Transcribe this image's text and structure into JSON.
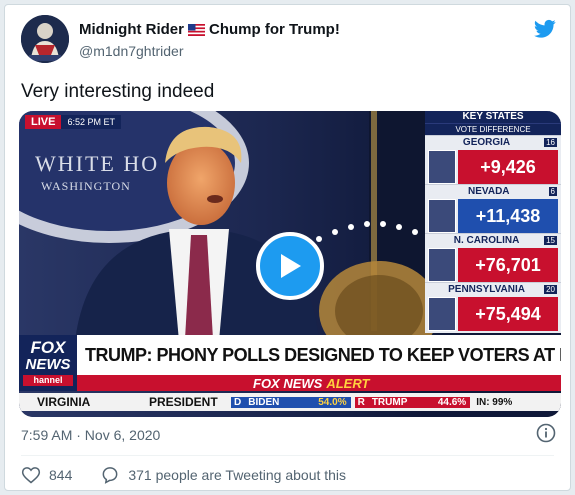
{
  "tweet": {
    "display_name": "Midnight Rider",
    "name_suffix": "Chump for Trump!",
    "handle": "@m1dn7ghtrider",
    "text": "Very interesting indeed",
    "timestamp": "7:59 AM · Nov 6, 2020",
    "likes": "844",
    "reply_label": "371 people are Tweeting about this"
  },
  "video": {
    "live_badge": "LIVE",
    "live_time": "6:52 PM ET",
    "backdrop_line1": "WHITE HO",
    "backdrop_line2": "WASHINGTON",
    "panel_header": "KEY STATES",
    "panel_subheader": "VOTE DIFFERENCE",
    "states": [
      {
        "name": "GEORGIA",
        "ev": "16",
        "margin": "+9,426",
        "color": "#c8102e"
      },
      {
        "name": "NEVADA",
        "ev": "6",
        "margin": "+11,438",
        "color": "#1f4fae"
      },
      {
        "name": "N. CAROLINA",
        "ev": "15",
        "margin": "+76,701",
        "color": "#c8102e"
      },
      {
        "name": "PENNSYLVANIA",
        "ev": "20",
        "margin": "+75,494",
        "color": "#c8102e"
      }
    ],
    "logo_line1": "FOX",
    "logo_line2": "NEWS",
    "logo_line3": "hannel",
    "headline": "TRUMP: PHONY POLLS DESIGNED TO KEEP VOTERS AT HOME",
    "alert_brand": "FOX NEWS",
    "alert_word": "ALERT",
    "ticker_state": "VIRGINIA",
    "ticker_race": "PRESIDENT",
    "dem_tag": "D",
    "dem_name": "BIDEN",
    "dem_pct": "54.0%",
    "rep_tag": "R",
    "rep_name": "TRUMP",
    "rep_pct": "44.6%",
    "reporting": "IN: 99%"
  },
  "colors": {
    "twitter_blue": "#1d9bf0",
    "fox_red": "#c8102e",
    "fox_navy": "#13245a",
    "dem_blue": "#1f4fae"
  },
  "icons": {
    "verified_badge": "us-flag-icon",
    "brand": "twitter-bird-icon",
    "play": "play-icon",
    "info": "info-icon",
    "like": "heart-icon",
    "reply": "reply-bubble-icon"
  }
}
